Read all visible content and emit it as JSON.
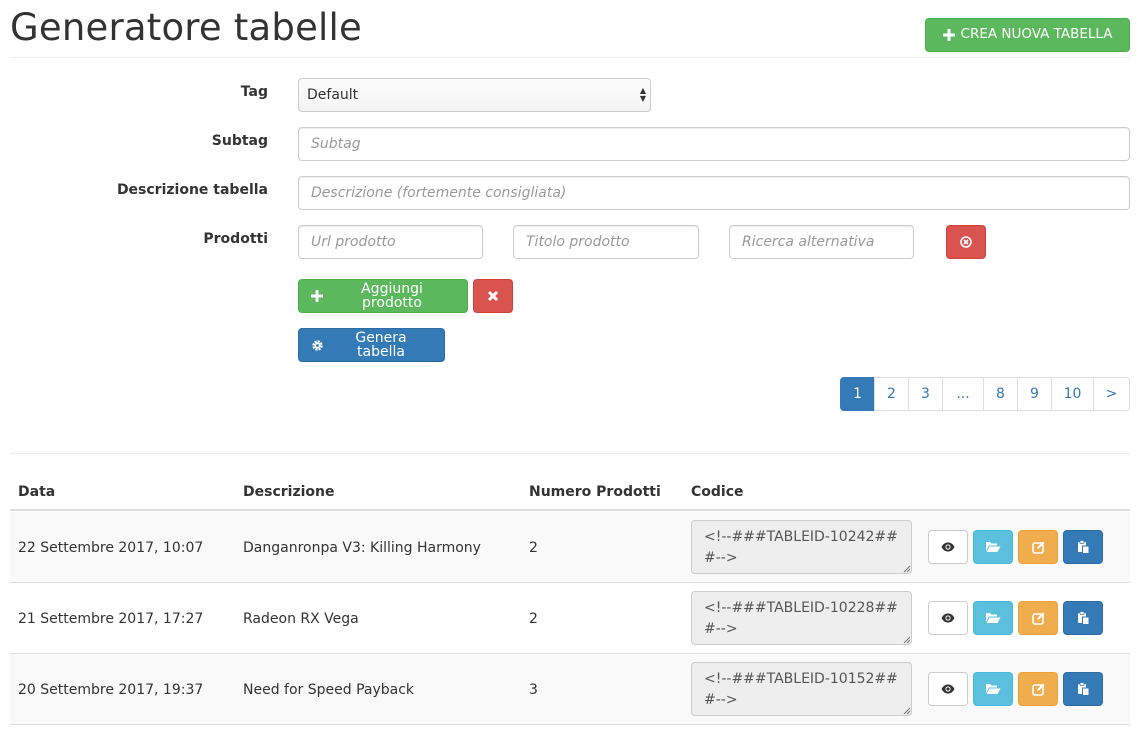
{
  "header": {
    "title": "Generatore tabelle",
    "create_button": "CREA NUOVA TABELLA"
  },
  "form": {
    "tag": {
      "label": "Tag",
      "value": "Default"
    },
    "subtag": {
      "label": "Subtag",
      "placeholder": "Subtag"
    },
    "descrizione": {
      "label": "Descrizione tabella",
      "placeholder": "Descrizione (fortemente consigliata)"
    },
    "prodotti": {
      "label": "Prodotti",
      "url_placeholder": "Url prodotto",
      "titolo_placeholder": "Titolo prodotto",
      "ricerca_placeholder": "Ricerca alternativa"
    },
    "add_product_button": "Aggiungi prodotto",
    "generate_button": "Genera tabella"
  },
  "pagination": [
    "1",
    "2",
    "3",
    "...",
    "8",
    "9",
    "10",
    ">"
  ],
  "table": {
    "columns": [
      "Data",
      "Descrizione",
      "Numero Prodotti",
      "Codice"
    ],
    "rows": [
      {
        "data": "22 Settembre 2017, 10:07",
        "descrizione": "Danganronpa V3: Killing Harmony",
        "numero": "2",
        "codice": "<!--###TABLEID-10242###-->"
      },
      {
        "data": "21 Settembre 2017, 17:27",
        "descrizione": "Radeon RX Vega",
        "numero": "2",
        "codice": "<!--###TABLEID-10228###-->"
      },
      {
        "data": "20 Settembre 2017, 19:37",
        "descrizione": "Need for Speed Payback",
        "numero": "3",
        "codice": "<!--###TABLEID-10152###-->"
      }
    ]
  },
  "colors": {
    "success": "#5cb85c",
    "danger": "#d9534f",
    "primary": "#337ab7",
    "info": "#5bc0de",
    "warning": "#f0ad4e"
  },
  "icons": [
    "plus-icon",
    "times-icon",
    "times-circle-icon",
    "gear-icon",
    "eye-icon",
    "folder-open-icon",
    "edit-icon",
    "paste-icon"
  ]
}
